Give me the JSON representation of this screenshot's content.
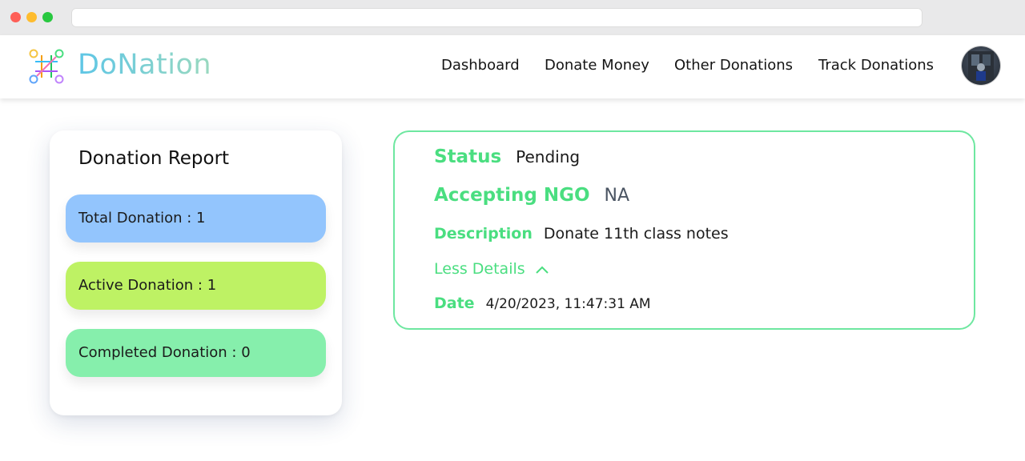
{
  "app": {
    "brand": "DoNation"
  },
  "nav": {
    "links": [
      "Dashboard",
      "Donate Money",
      "Other Donations",
      "Track Donations"
    ],
    "avatar_icon": "user-avatar"
  },
  "report": {
    "title": "Donation Report",
    "total_label": "Total Donation : 1",
    "active_label": "Active Donation : 1",
    "completed_label": "Completed Donation : 0",
    "colors": {
      "total": "#93c5fd",
      "active": "#bef264",
      "completed": "#86efac"
    }
  },
  "details": {
    "status_label": "Status",
    "status_value": "Pending",
    "ngo_label": "Accepting NGO",
    "ngo_value": "NA",
    "description_label": "Description",
    "description_value": "Donate 11th class notes",
    "toggle_label": "Less Details",
    "toggle_icon": "chevron-up-icon",
    "date_label": "Date",
    "date_value": "4/20/2023, 11:47:31 AM",
    "accent_color": "#4ade80"
  }
}
